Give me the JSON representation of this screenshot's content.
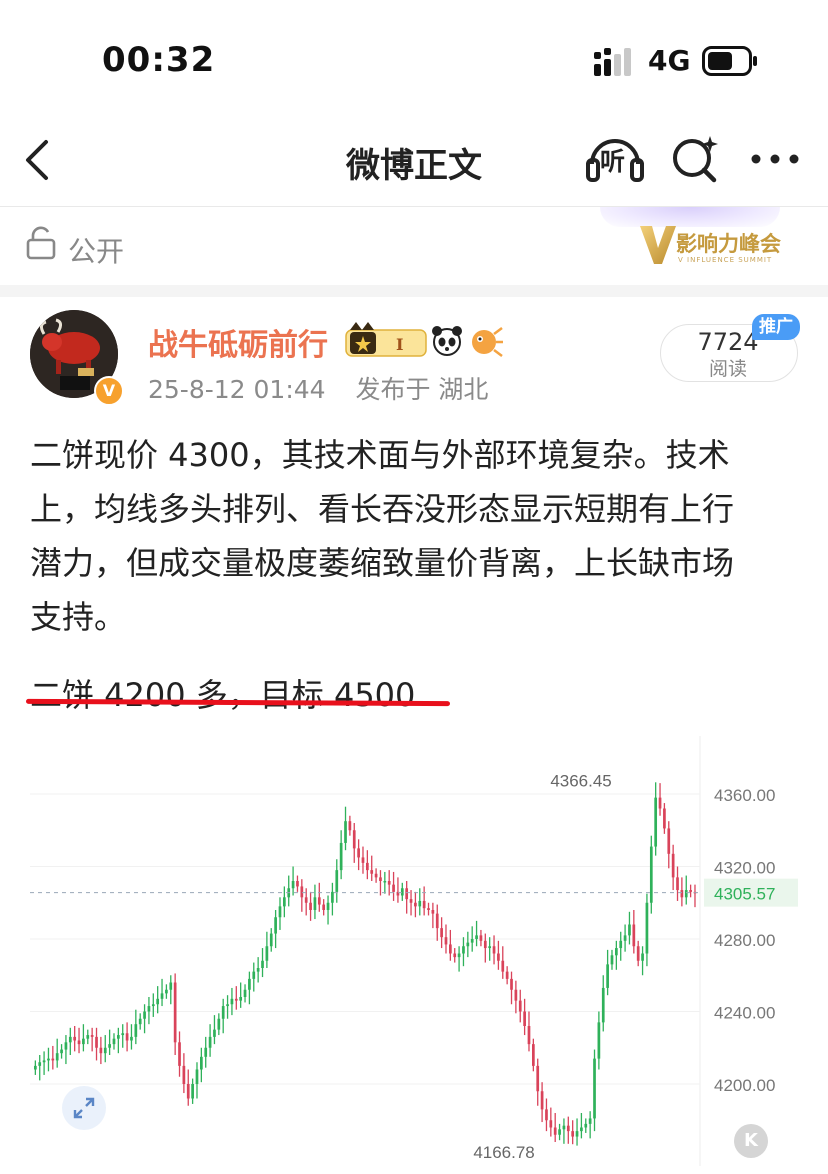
{
  "status_bar": {
    "time": "00:32",
    "network": "4G"
  },
  "nav": {
    "title": "微博正文",
    "listen_label": "听"
  },
  "visibility": {
    "label": "公开",
    "event_badge_text": "影响力峰会",
    "event_badge_sub": "V INFLUENCE SUMMIT"
  },
  "post": {
    "author": "战牛砥砺前行",
    "timestamp": "25-8-12 01:44",
    "location": "发布于 湖北",
    "read_count": "7724",
    "read_label": "阅读",
    "promo_tag": "推广",
    "body_lines": [
      "二饼现价 4300，其技术面与外部环境复杂。技术",
      "上，均线多头排列、看长吞没形态显示短期有上行",
      "潜力，但成交量极度萎缩致量价背离，上长缺市场",
      "支持。"
    ],
    "highlight": "二饼 4200 多，目标 4500",
    "avatar_badge": "V"
  },
  "colors": {
    "up": "#2fb15a",
    "down": "#d9435a",
    "accent_orange": "#eb7350",
    "underline": "#e8101c"
  },
  "chart_data": {
    "type": "candlestick",
    "y_ticks": [
      "4360.00",
      "4320.00",
      "4280.00",
      "4240.00",
      "4200.00"
    ],
    "y_tick_values": [
      4360,
      4320,
      4280,
      4240,
      4200
    ],
    "ylim": [
      4160,
      4380
    ],
    "current_price": "4305.57",
    "current_value": 4305.57,
    "max_label": "4366.45",
    "max_value": 4366.45,
    "min_label": "4166.78",
    "min_value": 4166.78,
    "grid": true,
    "closes": [
      4210,
      4212,
      4213,
      4214,
      4213,
      4217,
      4219,
      4223,
      4226,
      4224,
      4222,
      4225,
      4227,
      4226,
      4220,
      4217,
      4220,
      4222,
      4225,
      4227,
      4228,
      4224,
      4226,
      4233,
      4236,
      4240,
      4243,
      4244,
      4247,
      4250,
      4252,
      4256,
      4223,
      4210,
      4200,
      4192,
      4200,
      4208,
      4215,
      4220,
      4226,
      4230,
      4236,
      4243,
      4244,
      4247,
      4246,
      4248,
      4252,
      4258,
      4262,
      4264,
      4268,
      4276,
      4283,
      4292,
      4298,
      4303,
      4308,
      4312,
      4309,
      4303,
      4300,
      4296,
      4303,
      4299,
      4296,
      4300,
      4306,
      4318,
      4333,
      4345,
      4340,
      4330,
      4325,
      4322,
      4318,
      4316,
      4314,
      4312,
      4312,
      4310,
      4306,
      4304,
      4308,
      4302,
      4300,
      4298,
      4301,
      4297,
      4296,
      4294,
      4286,
      4281,
      4277,
      4272,
      4270,
      4272,
      4276,
      4278,
      4280,
      4282,
      4279,
      4275,
      4276,
      4272,
      4268,
      4262,
      4258,
      4252,
      4246,
      4240,
      4232,
      4222,
      4210,
      4196,
      4186,
      4180,
      4176,
      4172,
      4175,
      4177,
      4174,
      4171,
      4174,
      4176,
      4178,
      4181,
      4214,
      4234,
      4253,
      4266,
      4271,
      4275,
      4279,
      4282,
      4288,
      4276,
      4268,
      4272,
      4300,
      4331,
      4358,
      4352,
      4341,
      4327,
      4314,
      4307,
      4303,
      4307,
      4306,
      4305.57
    ]
  }
}
